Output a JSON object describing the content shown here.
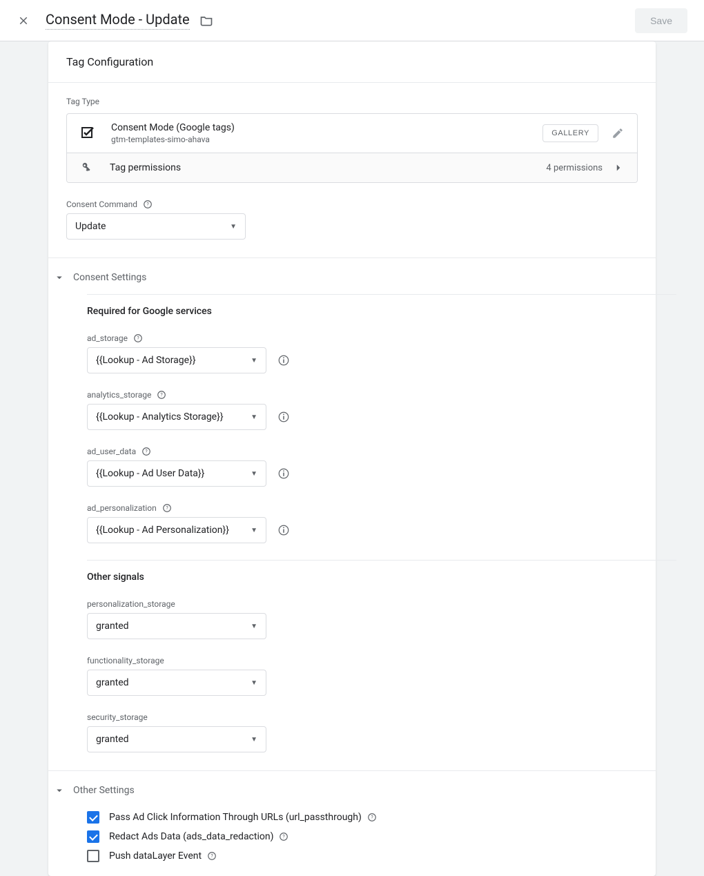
{
  "header": {
    "title": "Consent Mode - Update",
    "save_label": "Save"
  },
  "panel": {
    "heading": "Tag Configuration",
    "tag_type_label": "Tag Type",
    "tag_type": {
      "name": "Consent Mode (Google tags)",
      "provider": "gtm-templates-simo-ahava",
      "gallery_label": "GALLERY"
    },
    "permissions": {
      "label": "Tag permissions",
      "count_text": "4 permissions"
    },
    "consent_command": {
      "label": "Consent Command",
      "value": "Update"
    },
    "consent_settings_section": "Consent Settings",
    "required_heading": "Required for Google services",
    "fields": {
      "ad_storage": {
        "label": "ad_storage",
        "value": "{{Lookup - Ad Storage}}"
      },
      "analytics_storage": {
        "label": "analytics_storage",
        "value": "{{Lookup - Analytics Storage}}"
      },
      "ad_user_data": {
        "label": "ad_user_data",
        "value": "{{Lookup - Ad User Data}}"
      },
      "ad_personalization": {
        "label": "ad_personalization",
        "value": "{{Lookup - Ad Personalization}}"
      }
    },
    "other_signals_heading": "Other signals",
    "other_signals": {
      "personalization_storage": {
        "label": "personalization_storage",
        "value": "granted"
      },
      "functionality_storage": {
        "label": "functionality_storage",
        "value": "granted"
      },
      "security_storage": {
        "label": "security_storage",
        "value": "granted"
      }
    },
    "other_settings_section": "Other Settings",
    "checkboxes": {
      "url_passthrough": {
        "label": "Pass Ad Click Information Through URLs (url_passthrough)",
        "checked": true
      },
      "ads_redaction": {
        "label": "Redact Ads Data (ads_data_redaction)",
        "checked": true
      },
      "push_dl": {
        "label": "Push dataLayer Event",
        "checked": false
      }
    }
  }
}
